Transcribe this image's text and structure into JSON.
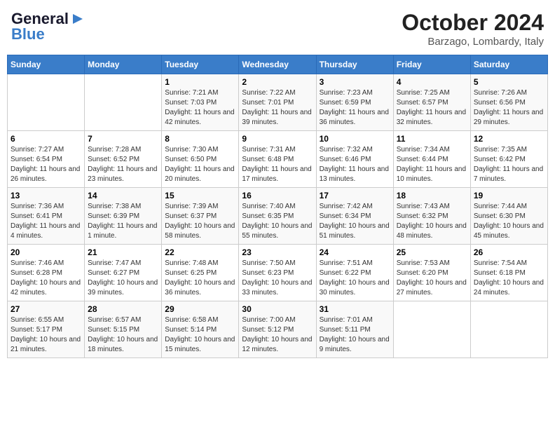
{
  "header": {
    "logo_general": "General",
    "logo_blue": "Blue",
    "month_title": "October 2024",
    "location": "Barzago, Lombardy, Italy"
  },
  "calendar": {
    "days_of_week": [
      "Sunday",
      "Monday",
      "Tuesday",
      "Wednesday",
      "Thursday",
      "Friday",
      "Saturday"
    ],
    "weeks": [
      [
        {
          "day": "",
          "info": ""
        },
        {
          "day": "",
          "info": ""
        },
        {
          "day": "1",
          "info": "Sunrise: 7:21 AM\nSunset: 7:03 PM\nDaylight: 11 hours and 42 minutes."
        },
        {
          "day": "2",
          "info": "Sunrise: 7:22 AM\nSunset: 7:01 PM\nDaylight: 11 hours and 39 minutes."
        },
        {
          "day": "3",
          "info": "Sunrise: 7:23 AM\nSunset: 6:59 PM\nDaylight: 11 hours and 36 minutes."
        },
        {
          "day": "4",
          "info": "Sunrise: 7:25 AM\nSunset: 6:57 PM\nDaylight: 11 hours and 32 minutes."
        },
        {
          "day": "5",
          "info": "Sunrise: 7:26 AM\nSunset: 6:56 PM\nDaylight: 11 hours and 29 minutes."
        }
      ],
      [
        {
          "day": "6",
          "info": "Sunrise: 7:27 AM\nSunset: 6:54 PM\nDaylight: 11 hours and 26 minutes."
        },
        {
          "day": "7",
          "info": "Sunrise: 7:28 AM\nSunset: 6:52 PM\nDaylight: 11 hours and 23 minutes."
        },
        {
          "day": "8",
          "info": "Sunrise: 7:30 AM\nSunset: 6:50 PM\nDaylight: 11 hours and 20 minutes."
        },
        {
          "day": "9",
          "info": "Sunrise: 7:31 AM\nSunset: 6:48 PM\nDaylight: 11 hours and 17 minutes."
        },
        {
          "day": "10",
          "info": "Sunrise: 7:32 AM\nSunset: 6:46 PM\nDaylight: 11 hours and 13 minutes."
        },
        {
          "day": "11",
          "info": "Sunrise: 7:34 AM\nSunset: 6:44 PM\nDaylight: 11 hours and 10 minutes."
        },
        {
          "day": "12",
          "info": "Sunrise: 7:35 AM\nSunset: 6:42 PM\nDaylight: 11 hours and 7 minutes."
        }
      ],
      [
        {
          "day": "13",
          "info": "Sunrise: 7:36 AM\nSunset: 6:41 PM\nDaylight: 11 hours and 4 minutes."
        },
        {
          "day": "14",
          "info": "Sunrise: 7:38 AM\nSunset: 6:39 PM\nDaylight: 11 hours and 1 minute."
        },
        {
          "day": "15",
          "info": "Sunrise: 7:39 AM\nSunset: 6:37 PM\nDaylight: 10 hours and 58 minutes."
        },
        {
          "day": "16",
          "info": "Sunrise: 7:40 AM\nSunset: 6:35 PM\nDaylight: 10 hours and 55 minutes."
        },
        {
          "day": "17",
          "info": "Sunrise: 7:42 AM\nSunset: 6:34 PM\nDaylight: 10 hours and 51 minutes."
        },
        {
          "day": "18",
          "info": "Sunrise: 7:43 AM\nSunset: 6:32 PM\nDaylight: 10 hours and 48 minutes."
        },
        {
          "day": "19",
          "info": "Sunrise: 7:44 AM\nSunset: 6:30 PM\nDaylight: 10 hours and 45 minutes."
        }
      ],
      [
        {
          "day": "20",
          "info": "Sunrise: 7:46 AM\nSunset: 6:28 PM\nDaylight: 10 hours and 42 minutes."
        },
        {
          "day": "21",
          "info": "Sunrise: 7:47 AM\nSunset: 6:27 PM\nDaylight: 10 hours and 39 minutes."
        },
        {
          "day": "22",
          "info": "Sunrise: 7:48 AM\nSunset: 6:25 PM\nDaylight: 10 hours and 36 minutes."
        },
        {
          "day": "23",
          "info": "Sunrise: 7:50 AM\nSunset: 6:23 PM\nDaylight: 10 hours and 33 minutes."
        },
        {
          "day": "24",
          "info": "Sunrise: 7:51 AM\nSunset: 6:22 PM\nDaylight: 10 hours and 30 minutes."
        },
        {
          "day": "25",
          "info": "Sunrise: 7:53 AM\nSunset: 6:20 PM\nDaylight: 10 hours and 27 minutes."
        },
        {
          "day": "26",
          "info": "Sunrise: 7:54 AM\nSunset: 6:18 PM\nDaylight: 10 hours and 24 minutes."
        }
      ],
      [
        {
          "day": "27",
          "info": "Sunrise: 6:55 AM\nSunset: 5:17 PM\nDaylight: 10 hours and 21 minutes."
        },
        {
          "day": "28",
          "info": "Sunrise: 6:57 AM\nSunset: 5:15 PM\nDaylight: 10 hours and 18 minutes."
        },
        {
          "day": "29",
          "info": "Sunrise: 6:58 AM\nSunset: 5:14 PM\nDaylight: 10 hours and 15 minutes."
        },
        {
          "day": "30",
          "info": "Sunrise: 7:00 AM\nSunset: 5:12 PM\nDaylight: 10 hours and 12 minutes."
        },
        {
          "day": "31",
          "info": "Sunrise: 7:01 AM\nSunset: 5:11 PM\nDaylight: 10 hours and 9 minutes."
        },
        {
          "day": "",
          "info": ""
        },
        {
          "day": "",
          "info": ""
        }
      ]
    ]
  }
}
